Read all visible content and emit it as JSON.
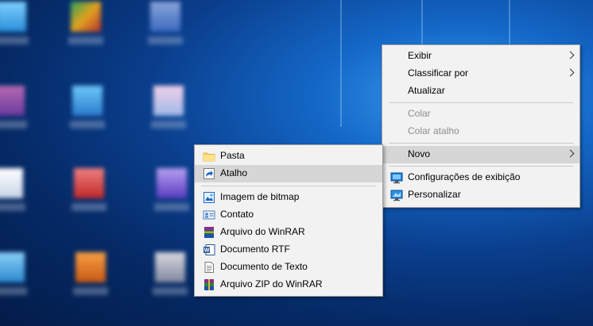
{
  "desktop_context_menu": {
    "items": [
      {
        "label": "Exibir",
        "has_submenu": true
      },
      {
        "label": "Classificar por",
        "has_submenu": true
      },
      {
        "label": "Atualizar"
      },
      {
        "label": "Colar",
        "disabled": true
      },
      {
        "label": "Colar atalho",
        "disabled": true
      },
      {
        "label": "Novo",
        "has_submenu": true,
        "highlighted": true
      },
      {
        "label": "Configurações de exibição",
        "icon": "display-settings-icon"
      },
      {
        "label": "Personalizar",
        "icon": "personalize-icon"
      }
    ]
  },
  "new_submenu": {
    "items": [
      {
        "label": "Pasta",
        "icon": "folder-icon"
      },
      {
        "label": "Atalho",
        "icon": "shortcut-icon",
        "highlighted": true
      },
      {
        "label": "Imagem de bitmap",
        "icon": "bitmap-icon"
      },
      {
        "label": "Contato",
        "icon": "contact-icon"
      },
      {
        "label": "Arquivo do WinRAR",
        "icon": "winrar-icon"
      },
      {
        "label": "Documento RTF",
        "icon": "word-rtf-icon"
      },
      {
        "label": "Documento de Texto",
        "icon": "text-document-icon"
      },
      {
        "label": "Arquivo ZIP do WinRAR",
        "icon": "winrar-zip-icon"
      }
    ]
  },
  "colors": {
    "menu_background": "#f2f2f2",
    "menu_highlight": "#d6d6d6",
    "disabled_text": "#8d8d8d",
    "desktop_blue": "#0a3e8c"
  }
}
